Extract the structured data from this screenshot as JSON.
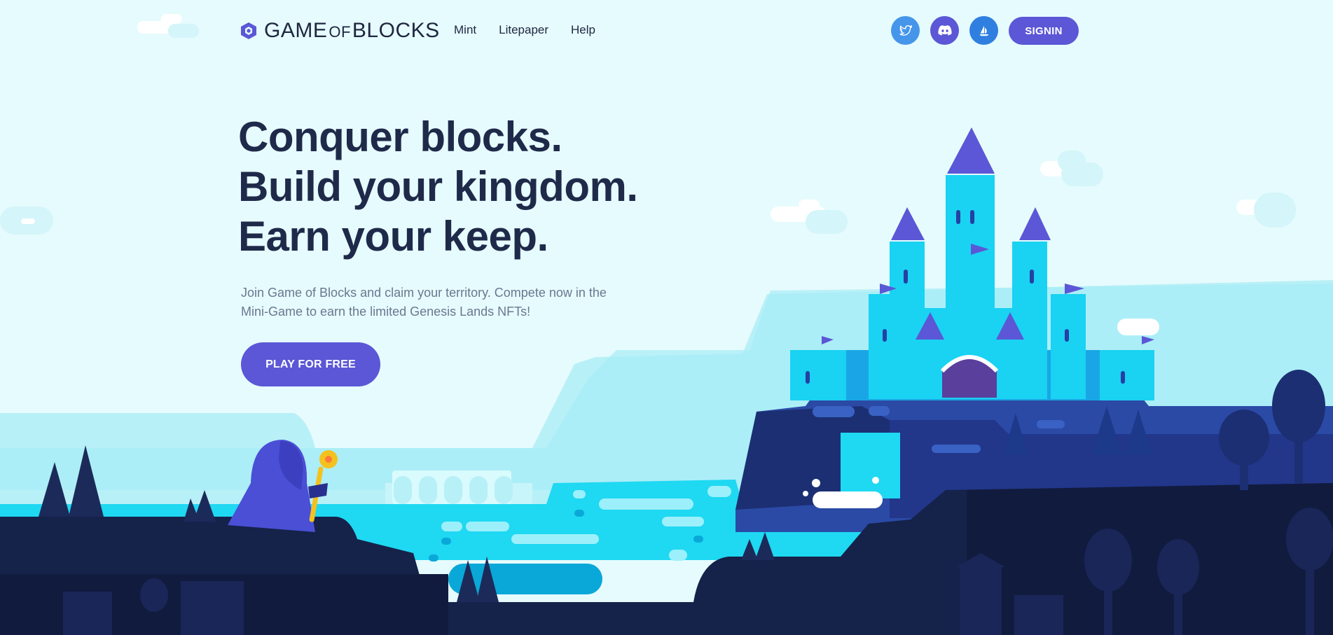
{
  "brand": {
    "name_part1": "GAME",
    "name_part2": "OF",
    "name_part3": "BLOCKS"
  },
  "nav": {
    "links": [
      {
        "label": "Mint"
      },
      {
        "label": "Litepaper"
      },
      {
        "label": "Help"
      }
    ],
    "social": [
      {
        "icon": "twitter-icon",
        "color": "#4596ea"
      },
      {
        "icon": "discord-icon",
        "color": "#5b57d6"
      },
      {
        "icon": "opensea-icon",
        "color": "#2f7fe0"
      }
    ],
    "signin_label": "SIGNIN"
  },
  "hero": {
    "title_lines": [
      "Conquer blocks.",
      "Build your kingdom.",
      "Earn your keep."
    ],
    "subtitle": "Join Game of Blocks and claim your territory. Compete now in the Mini-Game to earn the limited Genesis Lands NFTs!",
    "cta_label": "PLAY FOR FREE"
  },
  "colors": {
    "sky": "#e6fbfd",
    "accent": "#5b57d6",
    "water": "#1fd8f2",
    "ground_dark": "#15224a",
    "title": "#1f2a4a"
  }
}
